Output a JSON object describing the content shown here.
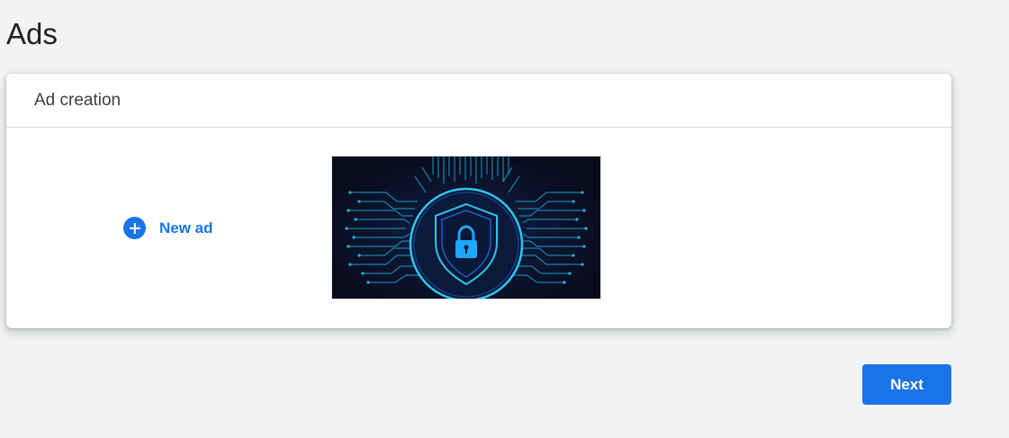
{
  "page": {
    "title": "Ads"
  },
  "card": {
    "header": "Ad creation",
    "new_ad": {
      "label": "New ad",
      "icon": "plus-circle-icon"
    },
    "ad_image": {
      "icon": "shield-lock-icon"
    }
  },
  "footer": {
    "next_label": "Next"
  },
  "colors": {
    "background": "#f1f3f4",
    "accent": "#1a73e8",
    "image_background": "#090c1d",
    "circuit": "#1fb5e6"
  }
}
